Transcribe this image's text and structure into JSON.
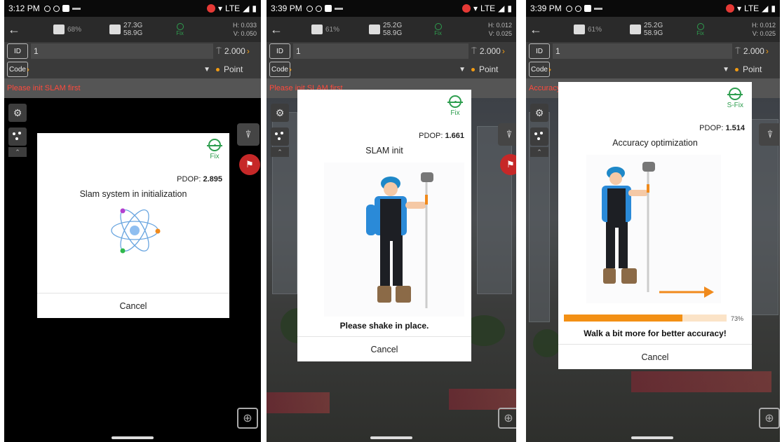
{
  "panels": [
    {
      "status": {
        "time": "3:12 PM",
        "network": "LTE"
      },
      "topbar": {
        "battery": "68%",
        "storage_top": "27.3G",
        "storage_bottom": "58.9G",
        "fix": "Fix",
        "h": "H: 0.033",
        "v": "V: 0.050"
      },
      "id_tag": "ID",
      "id_value": "1",
      "height_value": "2.000",
      "code_tag": "Code",
      "point_label": "Point",
      "warning": "Please init SLAM first",
      "dialog": {
        "fix": "Fix",
        "pdop_label": "PDOP:",
        "pdop_value": "2.895",
        "title": "Slam system in initialization",
        "cancel": "Cancel"
      }
    },
    {
      "status": {
        "time": "3:39 PM",
        "network": "LTE"
      },
      "topbar": {
        "battery": "61%",
        "storage_top": "25.2G",
        "storage_bottom": "58.9G",
        "fix": "Fix",
        "h": "H: 0.012",
        "v": "V: 0.025"
      },
      "id_tag": "ID",
      "id_value": "1",
      "height_value": "2.000",
      "code_tag": "Code",
      "point_label": "Point",
      "warning": "Please init SLAM first",
      "dialog": {
        "fix": "Fix",
        "pdop_label": "PDOP:",
        "pdop_value": "1.661",
        "title": "SLAM init",
        "hint": "Please shake in place.",
        "cancel": "Cancel"
      }
    },
    {
      "status": {
        "time": "3:39 PM",
        "network": "LTE"
      },
      "topbar": {
        "battery": "61%",
        "storage_top": "25.2G",
        "storage_bottom": "58.9G",
        "fix": "Fix",
        "h": "H: 0.012",
        "v": "V: 0.025"
      },
      "id_tag": "ID",
      "id_value": "1",
      "height_value": "2.000",
      "code_tag": "Code",
      "point_label": "Point",
      "warning": "Accuracy",
      "dialog": {
        "fix": "S-Fix",
        "pdop_label": "PDOP:",
        "pdop_value": "1.514",
        "title": "Accuracy optimization",
        "progress": 0.73,
        "progress_text": "73%",
        "hint": "Walk a bit more for better accuracy!",
        "cancel": "Cancel"
      }
    }
  ],
  "colors": {
    "fix_green": "#2e9e4f",
    "accent_orange": "#f39014",
    "warning_red": "#ff4a3d"
  },
  "icons": {
    "back": "arrow-left-icon",
    "receiver": "gnss-receiver-icon",
    "storage": "sd-card-icon",
    "settings": "gear-icon",
    "layers": "dots-icon",
    "collapse": "chevron-up-icon",
    "survey": "survey-pole-icon",
    "target": "crosshair-icon"
  }
}
